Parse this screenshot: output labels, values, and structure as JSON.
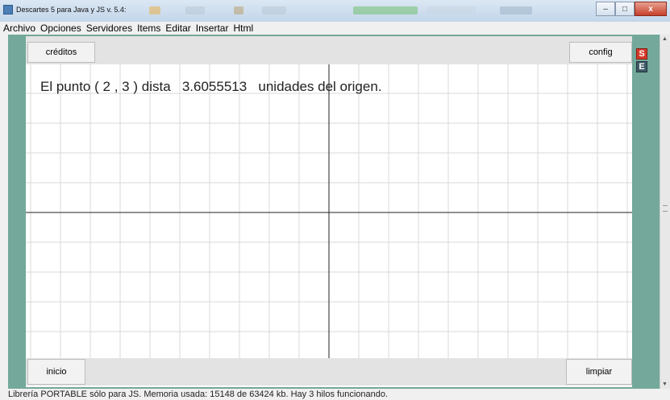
{
  "window": {
    "title": "Descartes 5 para Java y JS v. 5.4:",
    "controls": {
      "minimize": "–",
      "maximize": "□",
      "close": "x"
    }
  },
  "menu": [
    {
      "label": "Archivo"
    },
    {
      "label": "Opciones"
    },
    {
      "label": "Servidores"
    },
    {
      "label": "Items"
    },
    {
      "label": "Editar"
    },
    {
      "label": "Insertar"
    },
    {
      "label": "Html"
    }
  ],
  "scene": {
    "buttons": {
      "creditos": "créditos",
      "config": "config",
      "inicio": "inicio",
      "limpiar": "limpiar"
    },
    "side_buttons": {
      "s": "S",
      "e": "E"
    },
    "text": {
      "prefix": "El punto (",
      "x": "2",
      "comma": ",",
      "y": "3",
      "middle": ") dista",
      "distance": "3.6055513",
      "suffix": "unidades del origen."
    },
    "colors": {
      "grid": "#d9d9d9",
      "axes": "#222222",
      "background": "#ffffff",
      "frame": "#73a89a"
    }
  },
  "status": "Librería PORTABLE sólo para JS. Memoria usada: 15148 de 63424 kb. Hay 3 hilos funcionando."
}
